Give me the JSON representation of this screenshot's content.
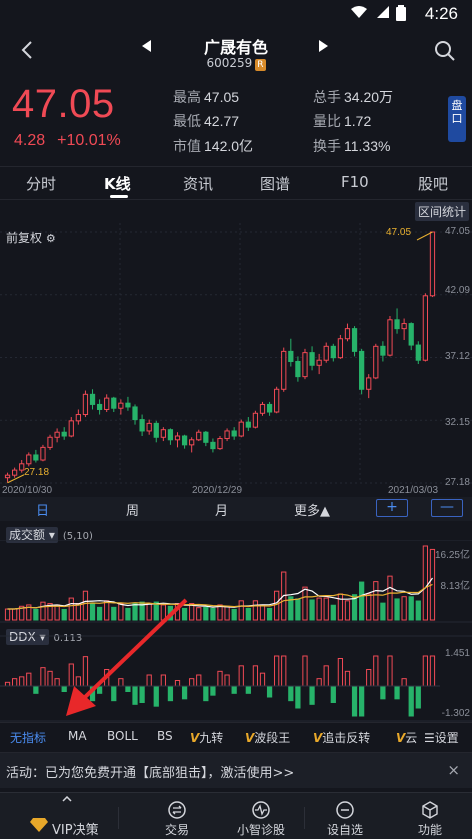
{
  "status": {
    "time": "4:26"
  },
  "header": {
    "name": "广晟有色",
    "code": "600259",
    "code_badge": "R"
  },
  "quote": {
    "price": "47.05",
    "change": "4.28",
    "change_pct": "+10.01%",
    "stats": [
      {
        "label": "最高",
        "value": "47.05"
      },
      {
        "label": "总手",
        "value": "34.20万"
      },
      {
        "label": "最低",
        "value": "42.77"
      },
      {
        "label": "量比",
        "value": "1.72"
      },
      {
        "label": "市值",
        "value": "142.0亿"
      },
      {
        "label": "换手",
        "value": "11.33%"
      }
    ],
    "pankou_label": "盘口"
  },
  "tabs": [
    {
      "label": "分时"
    },
    {
      "label": "K线"
    },
    {
      "label": "资讯"
    },
    {
      "label": "图谱"
    },
    {
      "label": "F10"
    },
    {
      "label": "股吧"
    }
  ],
  "kchart": {
    "range_stats": "区间统计",
    "adjust": "前复权",
    "high_label": "47.05",
    "low_label": "27.18",
    "y_ticks": [
      "47.05",
      "42.09",
      "37.12",
      "32.15",
      "27.18"
    ],
    "x_ticks": [
      "2020/10/30",
      "2020/12/29",
      "2021/03/03"
    ]
  },
  "periods": [
    "日",
    "周",
    "月",
    "更多▲"
  ],
  "zoom": {
    "in": "+",
    "out": "—"
  },
  "volume": {
    "name": "成交额",
    "params": "(5,10)",
    "y_ticks": [
      "16.25亿",
      "8.13亿"
    ]
  },
  "ddx": {
    "name": "DDX",
    "value": "0.113",
    "y_ticks": [
      "1.451",
      "-1.302"
    ]
  },
  "indicators": [
    "无指标",
    "MA",
    "BOLL",
    "BS",
    "九转",
    "波段王",
    "追击反转",
    "云",
    "设置"
  ],
  "indicator_v_mark": "V",
  "promo": {
    "text": "活动：已为您免费开通【底部狙击】，激活使用>>",
    "close": "×"
  },
  "bottom_nav": [
    {
      "label": "VIP决策"
    },
    {
      "label": "交易"
    },
    {
      "label": "小智诊股"
    },
    {
      "label": "设自选"
    },
    {
      "label": "功能"
    }
  ],
  "chart_data": {
    "type": "candlestick",
    "x_range": [
      "2020/10/30",
      "2021/03/03"
    ],
    "ylim": [
      27.18,
      47.05
    ],
    "y_ticks": [
      47.05,
      42.09,
      37.12,
      32.15,
      27.18
    ],
    "ohlc": [
      [
        27.6,
        28.0,
        27.2,
        27.8
      ],
      [
        27.8,
        28.4,
        27.6,
        28.2
      ],
      [
        28.2,
        29.0,
        28.0,
        28.7
      ],
      [
        28.7,
        29.6,
        28.5,
        29.4
      ],
      [
        29.4,
        29.8,
        28.8,
        29.0
      ],
      [
        29.0,
        30.2,
        28.9,
        30.0
      ],
      [
        30.0,
        31.0,
        29.8,
        30.8
      ],
      [
        30.8,
        31.5,
        30.4,
        31.2
      ],
      [
        31.2,
        31.6,
        30.6,
        30.9
      ],
      [
        30.9,
        32.4,
        30.8,
        32.1
      ],
      [
        32.1,
        33.0,
        31.8,
        32.6
      ],
      [
        32.6,
        34.5,
        32.4,
        34.2
      ],
      [
        34.2,
        34.6,
        33.0,
        33.4
      ],
      [
        33.4,
        33.8,
        32.6,
        33.0
      ],
      [
        33.0,
        34.2,
        32.8,
        33.9
      ],
      [
        33.9,
        34.0,
        32.8,
        33.1
      ],
      [
        33.1,
        33.8,
        32.6,
        33.5
      ],
      [
        33.5,
        34.0,
        32.9,
        33.2
      ],
      [
        33.2,
        33.4,
        31.8,
        32.2
      ],
      [
        32.2,
        32.6,
        30.9,
        31.3
      ],
      [
        31.3,
        32.2,
        31.0,
        31.9
      ],
      [
        31.9,
        32.1,
        30.4,
        30.8
      ],
      [
        30.8,
        31.6,
        30.5,
        31.4
      ],
      [
        31.4,
        31.5,
        30.2,
        30.6
      ],
      [
        30.6,
        31.2,
        30.0,
        30.9
      ],
      [
        30.9,
        31.0,
        29.9,
        30.2
      ],
      [
        30.2,
        30.8,
        29.6,
        30.6
      ],
      [
        30.6,
        31.4,
        30.5,
        31.2
      ],
      [
        31.2,
        31.3,
        30.1,
        30.4
      ],
      [
        30.4,
        30.7,
        29.6,
        29.9
      ],
      [
        29.9,
        30.9,
        29.8,
        30.7
      ],
      [
        30.7,
        31.5,
        30.5,
        31.3
      ],
      [
        31.3,
        31.6,
        30.6,
        30.9
      ],
      [
        30.9,
        32.2,
        30.8,
        32.0
      ],
      [
        32.0,
        32.4,
        31.3,
        31.6
      ],
      [
        31.6,
        32.9,
        31.5,
        32.7
      ],
      [
        32.7,
        33.6,
        32.5,
        33.4
      ],
      [
        33.4,
        33.6,
        32.5,
        32.8
      ],
      [
        32.8,
        34.8,
        32.7,
        34.6
      ],
      [
        34.6,
        37.9,
        34.4,
        37.6
      ],
      [
        37.6,
        38.6,
        36.4,
        36.8
      ],
      [
        36.8,
        37.2,
        35.2,
        35.6
      ],
      [
        35.6,
        37.8,
        35.4,
        37.5
      ],
      [
        37.5,
        38.0,
        36.1,
        36.5
      ],
      [
        36.5,
        37.4,
        35.8,
        36.9
      ],
      [
        36.9,
        38.3,
        36.7,
        38.0
      ],
      [
        38.0,
        38.2,
        36.8,
        37.1
      ],
      [
        37.1,
        38.9,
        37.0,
        38.6
      ],
      [
        38.6,
        39.8,
        38.4,
        39.4
      ],
      [
        39.4,
        39.6,
        37.2,
        37.6
      ],
      [
        37.6,
        37.8,
        34.2,
        34.6
      ],
      [
        34.6,
        35.8,
        33.9,
        35.5
      ],
      [
        35.5,
        38.2,
        35.4,
        38.0
      ],
      [
        38.0,
        38.4,
        36.8,
        37.3
      ],
      [
        37.3,
        40.4,
        37.2,
        40.1
      ],
      [
        40.1,
        41.0,
        39.0,
        39.4
      ],
      [
        39.4,
        40.2,
        38.5,
        39.8
      ],
      [
        39.8,
        39.9,
        37.7,
        38.1
      ],
      [
        38.1,
        38.4,
        36.6,
        36.9
      ],
      [
        36.9,
        42.2,
        36.8,
        42.0
      ],
      [
        42.0,
        47.05,
        41.9,
        47.05
      ]
    ]
  }
}
